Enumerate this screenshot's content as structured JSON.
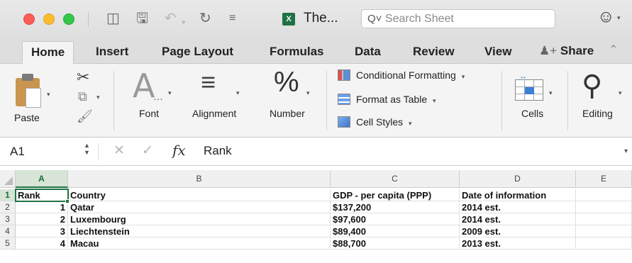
{
  "titlebar": {
    "doc_title": "The...",
    "search_placeholder": "Search Sheet",
    "excel_badge": "X"
  },
  "tabs": [
    "Home",
    "Insert",
    "Page Layout",
    "Formulas",
    "Data",
    "Review",
    "View"
  ],
  "active_tab": "Home",
  "share_label": "Share",
  "ribbon": {
    "paste": "Paste",
    "font": "Font",
    "alignment": "Alignment",
    "number": "Number",
    "number_glyph": "%",
    "font_glyph": "A",
    "conditional_formatting": "Conditional Formatting",
    "format_as_table": "Format as Table",
    "cell_styles": "Cell Styles",
    "cells": "Cells",
    "editing": "Editing"
  },
  "formula_bar": {
    "name_box": "A1",
    "fx": "fx",
    "content": "Rank"
  },
  "grid": {
    "columns": [
      "A",
      "B",
      "C",
      "D",
      "E"
    ],
    "rows": [
      "1",
      "2",
      "3",
      "4",
      "5"
    ],
    "header": {
      "rank": "Rank",
      "country": "Country",
      "gdp": "GDP - per capita (PPP)",
      "date": "Date of information"
    },
    "data": [
      {
        "rank": "1",
        "country": "Qatar",
        "gdp": "$137,200",
        "date": "2014 est."
      },
      {
        "rank": "2",
        "country": "Luxembourg",
        "gdp": "$97,600",
        "date": "2014 est."
      },
      {
        "rank": "3",
        "country": "Liechtenstein",
        "gdp": "$89,400",
        "date": "2009 est."
      },
      {
        "rank": "4",
        "country": "Macau",
        "gdp": "$88,700",
        "date": "2013 est."
      }
    ]
  },
  "colors": {
    "excel_green": "#217346",
    "accent_blue": "#3b7fd9"
  }
}
